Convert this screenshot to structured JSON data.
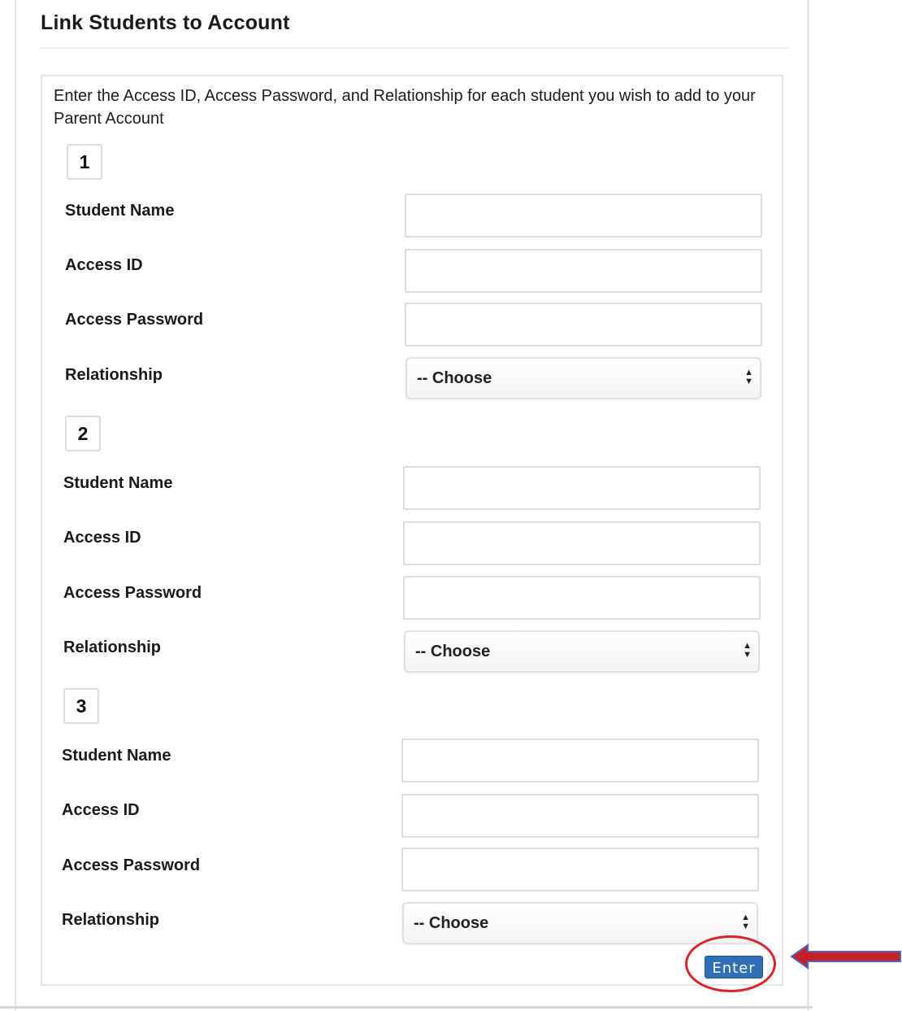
{
  "page": {
    "title": "Link Students to Account",
    "instructions": "Enter the Access ID, Access Password, and Relationship for each student you wish to add to your Parent Account"
  },
  "students": [
    {
      "number": "1",
      "student_name_label": "Student Name",
      "access_id_label": "Access ID",
      "access_password_label": "Access Password",
      "relationship_label": "Relationship",
      "relationship_value": "-- Choose",
      "student_name_value": "",
      "access_id_value": "",
      "access_password_value": ""
    },
    {
      "number": "2",
      "student_name_label": "Student Name",
      "access_id_label": "Access ID",
      "access_password_label": "Access Password",
      "relationship_label": "Relationship",
      "relationship_value": "-- Choose",
      "student_name_value": "",
      "access_id_value": "",
      "access_password_value": ""
    },
    {
      "number": "3",
      "student_name_label": "Student Name",
      "access_id_label": "Access ID",
      "access_password_label": "Access Password",
      "relationship_label": "Relationship",
      "relationship_value": "-- Choose",
      "student_name_value": "",
      "access_id_value": "",
      "access_password_value": ""
    }
  ],
  "actions": {
    "enter_label": "Enter"
  },
  "annotation": {
    "highlight_color": "#d9242a",
    "arrow_color": "#c62026",
    "arrow_outline_color": "#4a66c0"
  },
  "colors": {
    "button_blue": "#2f6fb8"
  }
}
